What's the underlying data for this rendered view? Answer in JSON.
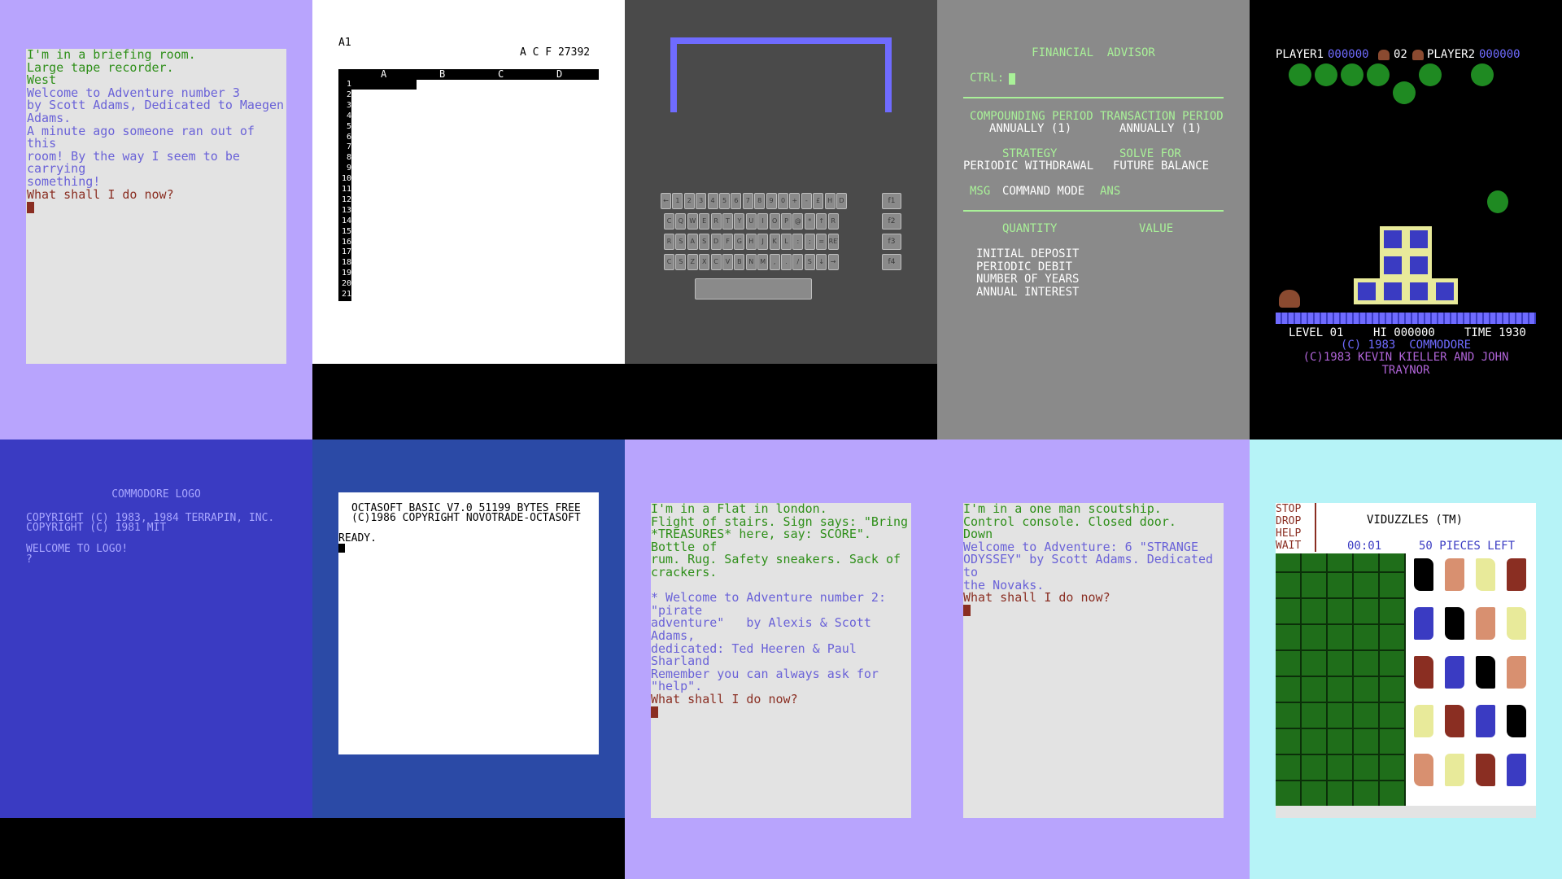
{
  "colors": {
    "c64_border_light": "#b8a4fd",
    "c64_screen_grey": "#e3e3e3",
    "adventure_green": "#2e8f19",
    "adventure_blue": "#6a62d8",
    "adventure_brown": "#8a2e22",
    "c64_blue": "#3a3bc2",
    "c64_light_blue": "#6f6bff",
    "c64_dark_grey": "#4a4a4a",
    "c64_mid_grey": "#8a8a8a",
    "c64_light_green": "#a9f198",
    "cyan": "#b6f3f7",
    "tree_green": "#1f8a22",
    "sand_yellow": "#e8ea9a"
  },
  "adventure3": {
    "green_lines": [
      "I'm in a briefing room.",
      "Large tape recorder.",
      "West"
    ],
    "blue_lines": [
      "Welcome to Adventure number 3",
      "by Scott Adams, Dedicated to Maegen",
      "Adams.",
      "A minute ago someone ran out of this",
      "room! By the way I seem to be carrying",
      "something!"
    ],
    "prompt": "What shall I do now?"
  },
  "spreadsheet": {
    "cell": "A1",
    "status": "A C F 27392",
    "columns": [
      "A",
      "B",
      "C",
      "D"
    ],
    "rows": [
      "1",
      "2",
      "3",
      "4",
      "5",
      "6",
      "7",
      "8",
      "9",
      "10",
      "11",
      "12",
      "13",
      "14",
      "15",
      "16",
      "17",
      "18",
      "19",
      "20",
      "21"
    ]
  },
  "keyboard": {
    "row1": [
      "←",
      "1",
      "2",
      "3",
      "4",
      "5",
      "6",
      "7",
      "8",
      "9",
      "0",
      "+",
      "-",
      "£",
      "H",
      "D"
    ],
    "row2": [
      "C",
      "Q",
      "W",
      "E",
      "R",
      "T",
      "Y",
      "U",
      "I",
      "O",
      "P",
      "@",
      "*",
      "↑",
      "R"
    ],
    "row3": [
      "R",
      "S",
      "A",
      "S",
      "D",
      "F",
      "G",
      "H",
      "J",
      "K",
      "L",
      ":",
      ";",
      "=",
      "RET"
    ],
    "row4": [
      "C",
      "S",
      "Z",
      "X",
      "C",
      "V",
      "B",
      "N",
      "M",
      ",",
      ".",
      "/",
      "S",
      "↓",
      "→"
    ],
    "fkeys": [
      "f1",
      "f2",
      "f3",
      "f4"
    ]
  },
  "financial": {
    "title": "FINANCIAL  ADVISOR",
    "ctrl": "CTRL:",
    "compounding_label": "COMPOUNDING PERIOD",
    "compounding_value": "ANNUALLY (1)",
    "transaction_label": "TRANSACTION PERIOD",
    "transaction_value": "ANNUALLY (1)",
    "strategy_label": "STRATEGY",
    "strategy_value": "PERIODIC WITHDRAWAL",
    "solve_label": "SOLVE FOR",
    "solve_value": "FUTURE BALANCE",
    "msg": "MSG",
    "mode": "COMMAND MODE",
    "ans": "ANS",
    "quantity": "QUANTITY",
    "value": "VALUE",
    "items": [
      "INITIAL DEPOSIT",
      "PERIODIC DEBIT",
      "NUMBER OF YEARS",
      "ANNUAL INTEREST"
    ]
  },
  "game": {
    "player1": "PLAYER1",
    "score1": "000000",
    "lives": "02",
    "player2": "PLAYER2",
    "score2": "000000",
    "level": "LEVEL 01",
    "hi": "HI 000000",
    "time": "TIME 1930",
    "copyright1": "(C) 1983  COMMODORE",
    "copyright2": "(C)1983 KEVIN KIELLER AND JOHN TRAYNOR"
  },
  "logo": {
    "title": "COMMODORE LOGO",
    "line1": "COPYRIGHT (C) 1983, 1984 TERRAPIN, INC.",
    "line2": "COPYRIGHT (C) 1981 MIT",
    "welcome": "WELCOME TO LOGO!",
    "prompt": "?"
  },
  "octasoft": {
    "line1": "OCTASOFT BASIC V7.0 51199 BYTES FREE",
    "line2": "(C)1986 COPYRIGHT NOVOTRADE-OCTASOFT",
    "ready": "READY."
  },
  "adventure2": {
    "green_lines": [
      "I'm in a Flat in london.",
      "Flight of stairs. Sign says: \"Bring",
      "*TREASURES* here, say: SCORE\". Bottle of",
      "rum. Rug. Safety sneakers. Sack of",
      "crackers."
    ],
    "blue_lines": [
      "* Welcome to Adventure number 2: \"pirate",
      "adventure\"   by Alexis & Scott Adams,",
      "dedicated: Ted Heeren & Paul Sharland",
      "Remember you can always ask for \"help\"."
    ],
    "prompt": "What shall I do now?"
  },
  "adventure6": {
    "green_lines": [
      "I'm in a one man scoutship.",
      "Control console. Closed door.",
      "Down"
    ],
    "blue_lines": [
      "Welcome to Adventure: 6 \"STRANGE",
      "ODYSSEY\" by Scott Adams. Dedicated to",
      "the Novaks."
    ],
    "prompt": "What shall I do now?"
  },
  "viduzzles": {
    "menu": [
      "STOP",
      "DROP",
      "HELP",
      "WAIT"
    ],
    "title": "VIDUZZLES (TM)",
    "timer": "00:01",
    "pieces": "50 PIECES LEFT"
  }
}
